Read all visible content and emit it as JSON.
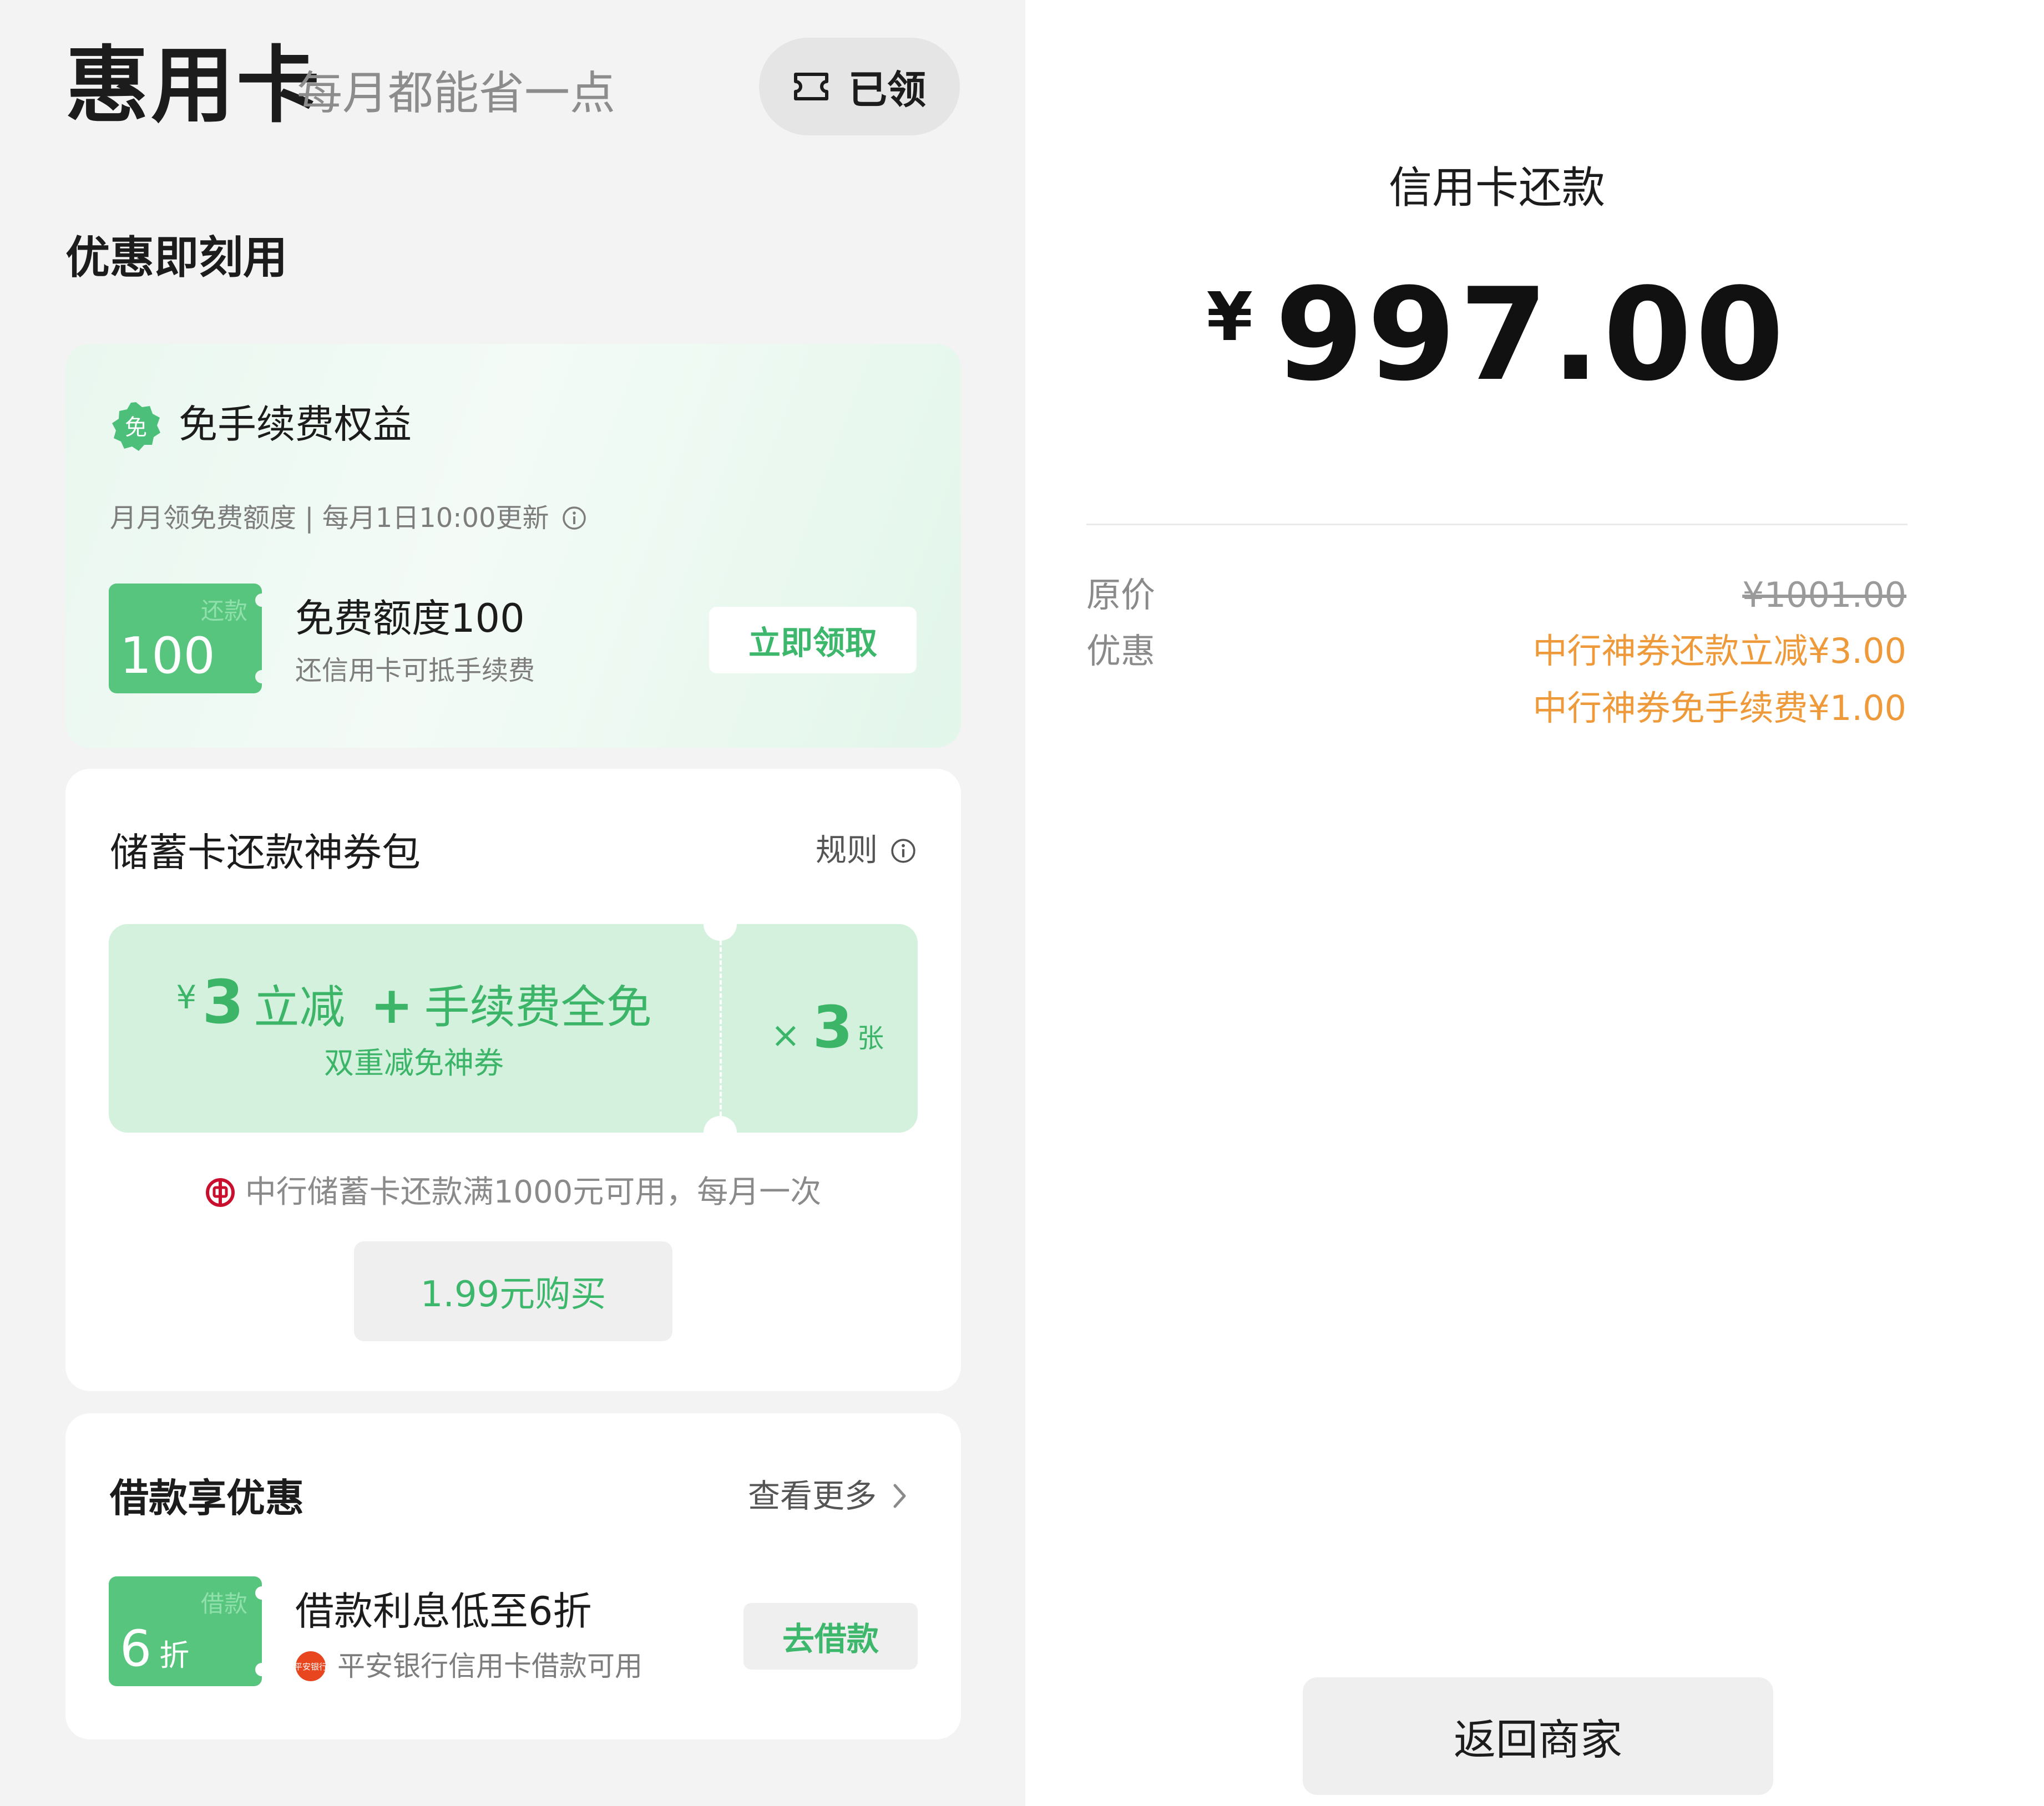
{
  "header": {
    "title": "惠用卡",
    "subtitle": "每月都能省一点",
    "claimed_label": "已领"
  },
  "section_title": "优惠即刻用",
  "fee_benefit": {
    "badge_text": "免",
    "title": "免手续费权益",
    "note": "月月领免费额度 | 每月1日10:00更新",
    "ticket_tag": "还款",
    "ticket_value": "100",
    "line1": "免费额度100",
    "line2": "还信用卡可抵手续费",
    "button": "立即领取"
  },
  "coupon_pack": {
    "title": "储蓄卡还款神券包",
    "rules_label": "规则",
    "yen": "¥",
    "discount_amount": "3",
    "discount_text": "立减",
    "plus": "+",
    "fee_text": "手续费全免",
    "subtitle": "双重减免神券",
    "times_symbol": "×",
    "count": "3",
    "count_unit": "张",
    "condition": "中行储蓄卡还款满1000元可用，每月一次",
    "buy_button": "1.99元购买"
  },
  "loan": {
    "title": "借款享优惠",
    "see_more": "查看更多",
    "ticket_tag": "借款",
    "ticket_value": "6",
    "ticket_unit": "折",
    "line1": "借款利息低至6折",
    "line2": "平安银行信用卡借款可用",
    "bank_logo_text": "平安银行",
    "button": "去借款"
  },
  "payment": {
    "title": "信用卡还款",
    "currency": "¥",
    "amount": "997.00",
    "original_label": "原价",
    "original_value": "¥1001.00",
    "discount_label": "优惠",
    "discount_1": "中行神券还款立减¥3.00",
    "discount_2": "中行神券免手续费¥1.00",
    "back_button": "返回商家"
  },
  "colors": {
    "accent_green": "#3db76b",
    "ticket_green": "#57c57e",
    "coupon_bg": "#d4f1dd",
    "discount_orange": "#ef9a3a",
    "boc_red": "#c8102e",
    "pingan_orange": "#e8461e"
  },
  "icons": [
    "ticket-icon",
    "mian-badge-icon",
    "info-icon",
    "boc-logo-icon",
    "pingan-logo-icon",
    "chevron-right-icon"
  ]
}
